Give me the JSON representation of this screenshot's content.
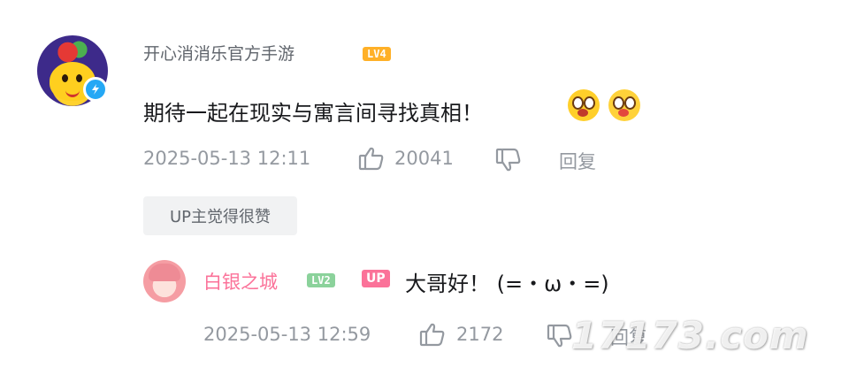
{
  "comment": {
    "username": "开心消消乐官方手游",
    "level": "LV4",
    "text": "期待一起在现实与寓言间寻找真相！",
    "emojis": [
      "shocked-emoji",
      "stunned-emoji"
    ],
    "timestamp": "2025-05-13 12:11",
    "like_count": "20041",
    "reply_label": "回复",
    "up_liked_tag": "UP主觉得很赞"
  },
  "reply": {
    "username": "白银之城",
    "level": "LV2",
    "up_tag": "UP",
    "text": "大哥好！ (=・ω・=)",
    "timestamp": "2025-05-13 12:59",
    "like_count": "2172",
    "reply_label": "回复"
  },
  "watermark": "17173.com",
  "colors": {
    "username_main": "#61666d",
    "username_up": "#fb7299",
    "meta": "#9499a0",
    "level4": "#ffb027",
    "level2": "#8bd29b",
    "verify": "#25a8f5",
    "tag_bg": "#f1f2f3"
  }
}
